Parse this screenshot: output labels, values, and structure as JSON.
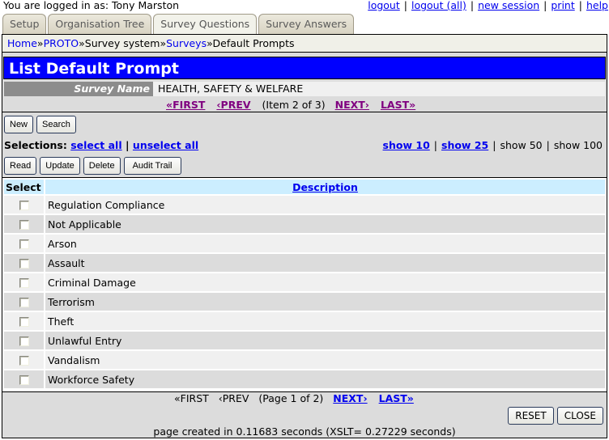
{
  "topbar": {
    "logged_in_text": "You are logged in as:  Tony Marston",
    "links": [
      "logout",
      "logout (all)",
      "new session",
      "print",
      "help"
    ]
  },
  "tabs": [
    {
      "label": "Setup",
      "active": false
    },
    {
      "label": "Organisation Tree",
      "active": false
    },
    {
      "label": "Survey Questions",
      "active": true
    },
    {
      "label": "Survey Answers",
      "active": false
    }
  ],
  "breadcrumb": [
    {
      "label": "Home",
      "link": true
    },
    {
      "label": "PROTO",
      "link": true
    },
    {
      "label": "Survey system",
      "link": false
    },
    {
      "label": "Surveys",
      "link": true
    },
    {
      "label": "Default Prompts",
      "link": false
    }
  ],
  "breadcrumb_separator": "»",
  "page_title": "List Default Prompt",
  "survey": {
    "label": "Survey Name",
    "value": "HEALTH, SAFETY & WELFARE"
  },
  "item_nav": {
    "first": "«FIRST",
    "prev": "‹PREV",
    "position": "(Item 2 of 3)",
    "next": "NEXT›",
    "last": "LAST»"
  },
  "toolbar1": {
    "new": "New",
    "search": "Search"
  },
  "selections": {
    "label": "Selections:",
    "select_all": "select all",
    "separator": "|",
    "unselect_all": "unselect all"
  },
  "show": {
    "show10": "show 10",
    "show25": "show 25",
    "show50": "show 50",
    "show100": "show 100"
  },
  "toolbar2": {
    "read": "Read",
    "update": "Update",
    "delete": "Delete",
    "audit": "Audit Trail"
  },
  "table": {
    "headers": {
      "select": "Select",
      "description": "Description"
    },
    "rows": [
      {
        "description": "Regulation Compliance",
        "checked": false
      },
      {
        "description": "Not Applicable",
        "checked": false
      },
      {
        "description": "Arson",
        "checked": false
      },
      {
        "description": "Assault",
        "checked": false
      },
      {
        "description": "Criminal Damage",
        "checked": false
      },
      {
        "description": "Terrorism",
        "checked": false
      },
      {
        "description": "Theft",
        "checked": false
      },
      {
        "description": "Unlawful Entry",
        "checked": false
      },
      {
        "description": "Vandalism",
        "checked": false
      },
      {
        "description": "Workforce Safety",
        "checked": false
      }
    ]
  },
  "page_nav": {
    "first": "«FIRST",
    "prev": "‹PREV",
    "position": "(Page 1 of 2)",
    "next": "NEXT›",
    "last": "LAST»"
  },
  "actions": {
    "reset": "RESET",
    "close": "CLOSE"
  },
  "footer": "page created in 0.11683 seconds (XSLT= 0.27229 seconds)",
  "colors": {
    "title_bg": "#0000ff",
    "header_bg": "#cceeff",
    "link": "#0000ee",
    "visited_link": "#800080"
  }
}
